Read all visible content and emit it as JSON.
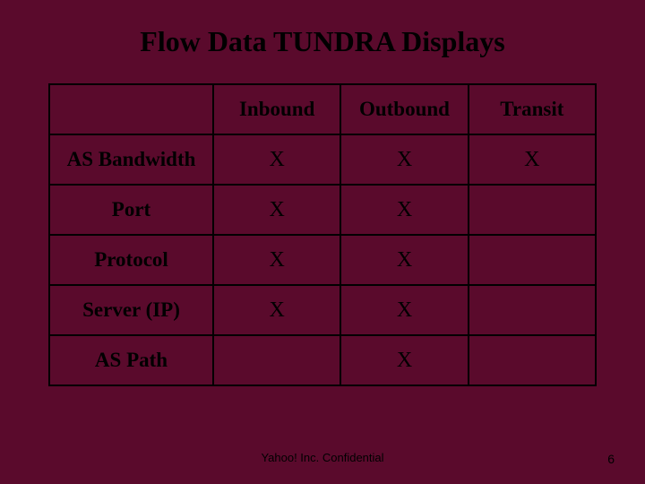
{
  "title": "Flow Data TUNDRA Displays",
  "footer": "Yahoo! Inc. Confidential",
  "page_number": "6",
  "table": {
    "corner": "",
    "columns": [
      "Inbound",
      "Outbound",
      "Transit"
    ],
    "rows": [
      {
        "label": "AS Bandwidth",
        "cells": [
          "X",
          "X",
          "X"
        ]
      },
      {
        "label": "Port",
        "cells": [
          "X",
          "X",
          ""
        ]
      },
      {
        "label": "Protocol",
        "cells": [
          "X",
          "X",
          ""
        ]
      },
      {
        "label": "Server (IP)",
        "cells": [
          "X",
          "X",
          ""
        ]
      },
      {
        "label": "AS Path",
        "cells": [
          "",
          "X",
          ""
        ]
      }
    ]
  },
  "chart_data": {
    "type": "table",
    "title": "Flow Data TUNDRA Displays",
    "columns": [
      "",
      "Inbound",
      "Outbound",
      "Transit"
    ],
    "rows": [
      [
        "AS Bandwidth",
        "X",
        "X",
        "X"
      ],
      [
        "Port",
        "X",
        "X",
        ""
      ],
      [
        "Protocol",
        "X",
        "X",
        ""
      ],
      [
        "Server (IP)",
        "X",
        "X",
        ""
      ],
      [
        "AS Path",
        "",
        "X",
        ""
      ]
    ]
  }
}
